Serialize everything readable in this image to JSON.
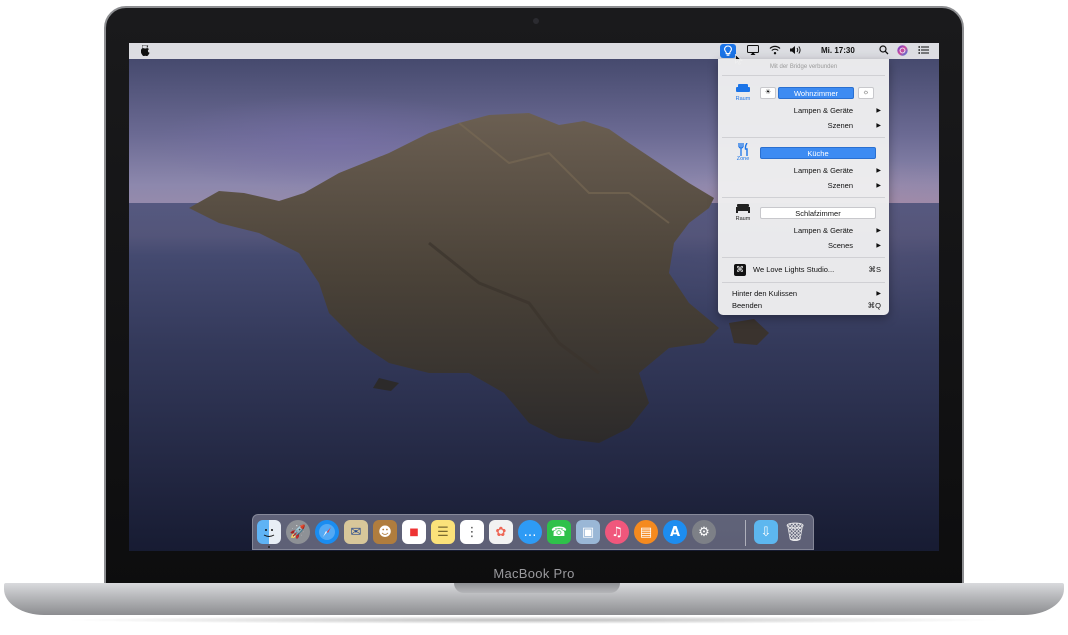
{
  "device": {
    "label": "MacBook Pro"
  },
  "menubar": {
    "clock": "Mi. 17:30",
    "icons": [
      "apple-icon",
      "hue-app-icon",
      "airplay-icon",
      "wifi-icon",
      "volume-icon",
      "spotlight-icon",
      "siri-icon",
      "notification-center-icon"
    ]
  },
  "dropdown": {
    "status": "Mit der Bridge verbunden",
    "groups": [
      {
        "type": "Raum",
        "name": "Wohnzimmer",
        "icon": "sofa-icon",
        "items": [
          {
            "label": "Lampen & Geräte"
          },
          {
            "label": "Szenen"
          }
        ]
      },
      {
        "type": "Zone",
        "name": "Küche",
        "icon": "fork-knife-icon",
        "items": [
          {
            "label": "Lampen & Geräte"
          },
          {
            "label": "Szenen"
          }
        ]
      },
      {
        "type": "Raum",
        "name": "Schlafzimmer",
        "icon": "bed-icon",
        "items": [
          {
            "label": "Lampen & Geräte"
          },
          {
            "label": "Scenes"
          }
        ]
      }
    ],
    "studio": {
      "label": "We Love Lights Studio...",
      "shortcut": "⌘S"
    },
    "behind": {
      "label": "Hinter den Kulissen"
    },
    "quit": {
      "label": "Beenden",
      "shortcut": "⌘Q"
    }
  },
  "dock": {
    "apps": [
      "finder-icon",
      "launchpad-icon",
      "safari-icon",
      "mail-icon",
      "contacts-icon",
      "calendar-icon",
      "notes-icon",
      "reminders-icon",
      "photos-icon",
      "messages-icon",
      "facetime-icon",
      "preview-icon",
      "music-icon",
      "books-icon",
      "app-store-icon",
      "system-preferences-icon",
      "downloads-folder-icon",
      "trash-icon"
    ]
  },
  "colors": {
    "accent": "#1b74e8",
    "pill_blue": "#3d8bf2"
  }
}
